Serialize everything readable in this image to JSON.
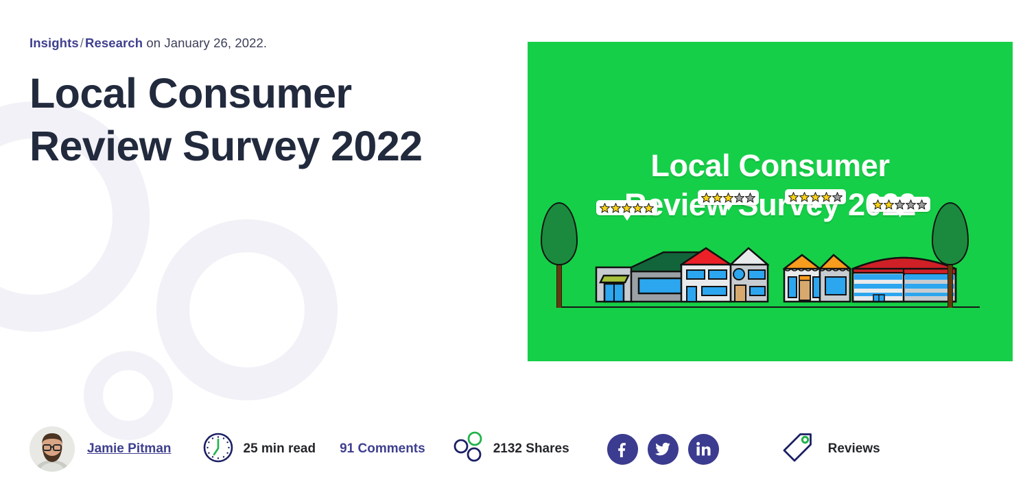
{
  "breadcrumb": {
    "category": "Insights",
    "separator": "/",
    "subcategory": "Research",
    "date_suffix": " on January 26, 2022."
  },
  "article": {
    "title": "Local Consumer Review Survey 2022"
  },
  "hero": {
    "title_line1": "Local Consumer",
    "title_line2": "Review Survey 2022",
    "background_color": "#16cf48",
    "title_color": "#ffffff",
    "illustration": {
      "star_color_filled": "#f7d117",
      "star_color_empty": "#9d9d9d",
      "buildings": [
        {
          "name": "shop-green-roof",
          "rating": 5,
          "max_rating": 5
        },
        {
          "name": "house-red-roof",
          "rating": 3,
          "max_rating": 5
        },
        {
          "name": "store-orange-awning",
          "rating": 4,
          "max_rating": 5
        },
        {
          "name": "office-blue-stripes",
          "rating": 2,
          "max_rating": 5
        }
      ],
      "trees": 2
    }
  },
  "meta": {
    "author": "Jamie Pitman",
    "read_time": "25 min read",
    "comments": "91 Comments",
    "shares": "2132 Shares",
    "tag": "Reviews",
    "social_links": [
      {
        "name": "facebook",
        "label": "Facebook"
      },
      {
        "name": "twitter",
        "label": "Twitter"
      },
      {
        "name": "linkedin",
        "label": "LinkedIn"
      }
    ]
  },
  "colors": {
    "accent_green": "#16cf48",
    "brand_navy": "#3f3f8f",
    "title_dark": "#222a3d",
    "social_circle": "#3b3b8f",
    "decor_ring": "#f1f1f7"
  }
}
